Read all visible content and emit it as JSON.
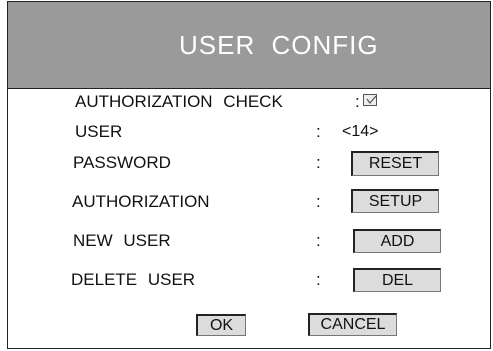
{
  "dialog": {
    "title": "USER CONFIG",
    "colon": ":"
  },
  "rows": {
    "authorization_check": {
      "label": "AUTHORIZATION CHECK",
      "checked": true
    },
    "user": {
      "label": "USER",
      "value": "<14>"
    },
    "password": {
      "label": "PASSWORD",
      "button": "RESET"
    },
    "authorization": {
      "label": "AUTHORIZATION",
      "button": "SETUP"
    },
    "new_user": {
      "label": "NEW USER",
      "button": "ADD"
    },
    "delete_user": {
      "label": "DELETE USER",
      "button": "DEL"
    }
  },
  "footer": {
    "ok": "OK",
    "cancel": "CANCEL"
  }
}
